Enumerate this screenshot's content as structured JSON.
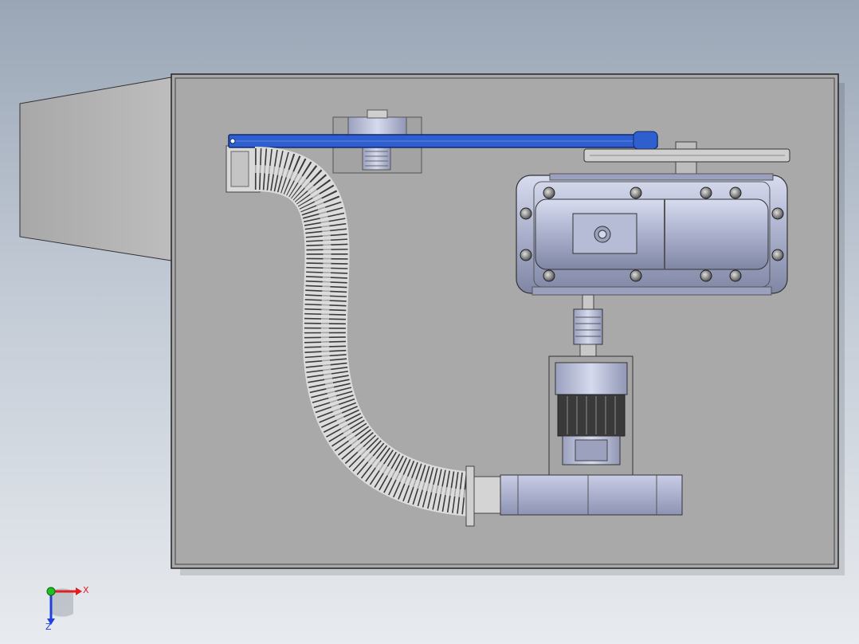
{
  "viewport": {
    "model": "cad-assembly-top-view",
    "components": [
      "enclosure-frame",
      "side-hood",
      "drive-belt",
      "idler-pulley",
      "flexible-hose",
      "gearbox",
      "shaft-coupling",
      "motor",
      "blower-housing"
    ]
  },
  "triad": {
    "x_label": "X",
    "z_label": "Z",
    "x_color": "#e02020",
    "y_color": "#20c020",
    "z_color": "#2040e0"
  },
  "colors": {
    "belt": "#2f5fcf",
    "panel": "#a9a9a9",
    "steel": "#aab0cc",
    "background_top": "#9aa6b6",
    "background_bottom": "#e8ebef"
  }
}
